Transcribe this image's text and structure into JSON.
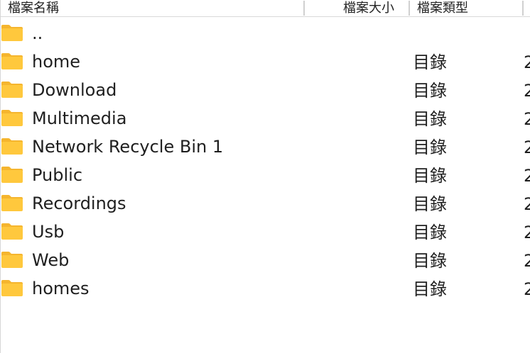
{
  "columns": {
    "name": "檔案名稱",
    "size": "檔案大小",
    "type": "檔案類型",
    "date": ""
  },
  "folder_icon": "folder-icon",
  "folder_color": "#ffc83d",
  "rows": [
    {
      "name": "..",
      "type": "",
      "date": ""
    },
    {
      "name": "home",
      "type": "目錄",
      "date": "2"
    },
    {
      "name": "Download",
      "type": "目錄",
      "date": "2"
    },
    {
      "name": "Multimedia",
      "type": "目錄",
      "date": "2"
    },
    {
      "name": "Network Recycle Bin 1",
      "type": "目錄",
      "date": "2"
    },
    {
      "name": "Public",
      "type": "目錄",
      "date": "2"
    },
    {
      "name": "Recordings",
      "type": "目錄",
      "date": "2"
    },
    {
      "name": "Usb",
      "type": "目錄",
      "date": "2"
    },
    {
      "name": "Web",
      "type": "目錄",
      "date": "2"
    },
    {
      "name": "homes",
      "type": "目錄",
      "date": "2"
    }
  ]
}
